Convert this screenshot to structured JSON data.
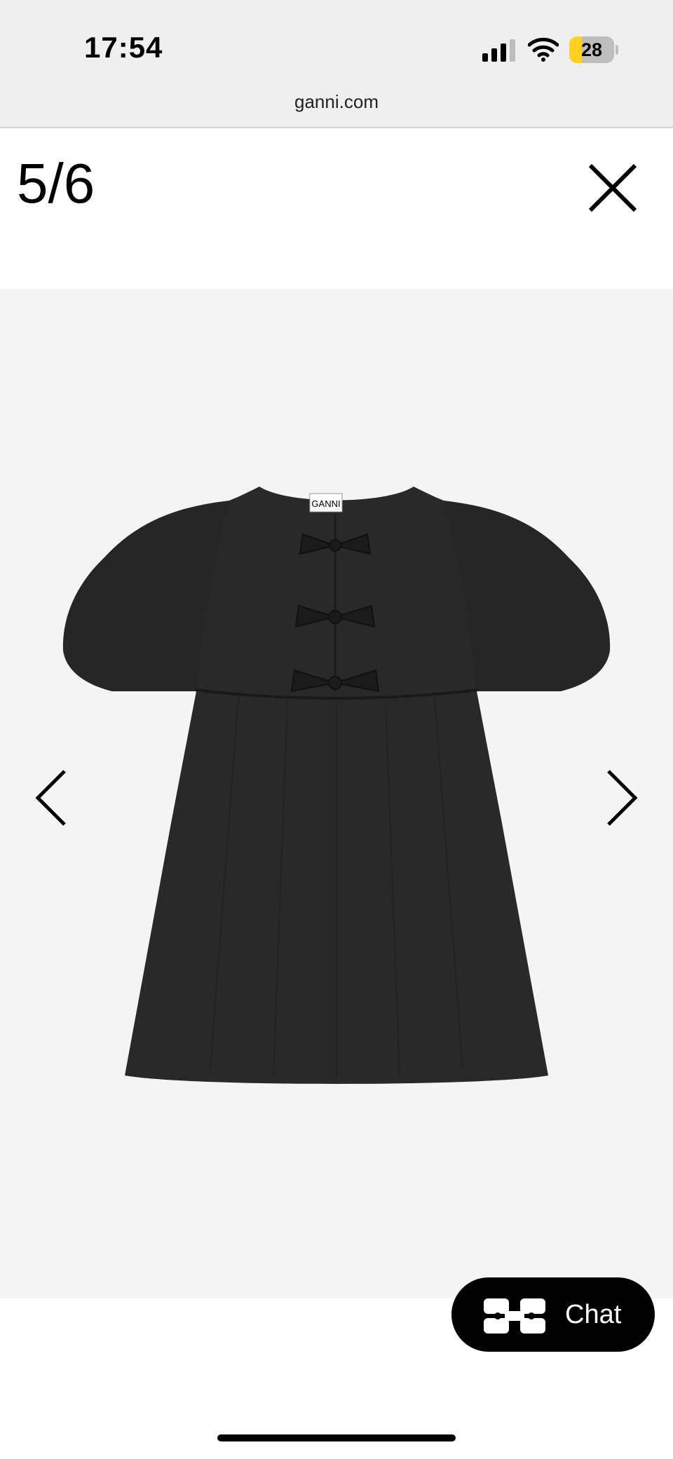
{
  "status_bar": {
    "time": "17:54",
    "battery_level": "28",
    "battery_fraction": 0.28,
    "battery_color": "#ffd21f",
    "icons": [
      "signal-icon",
      "wifi-icon",
      "battery-icon"
    ]
  },
  "browser": {
    "url": "ganni.com"
  },
  "gallery": {
    "counter": "5/6",
    "brand_label": "GANNI",
    "icons": [
      "close-icon",
      "chevron-left-icon",
      "chevron-right-icon"
    ]
  },
  "chat": {
    "label": "Chat",
    "icon": "chat-logo-icon"
  }
}
